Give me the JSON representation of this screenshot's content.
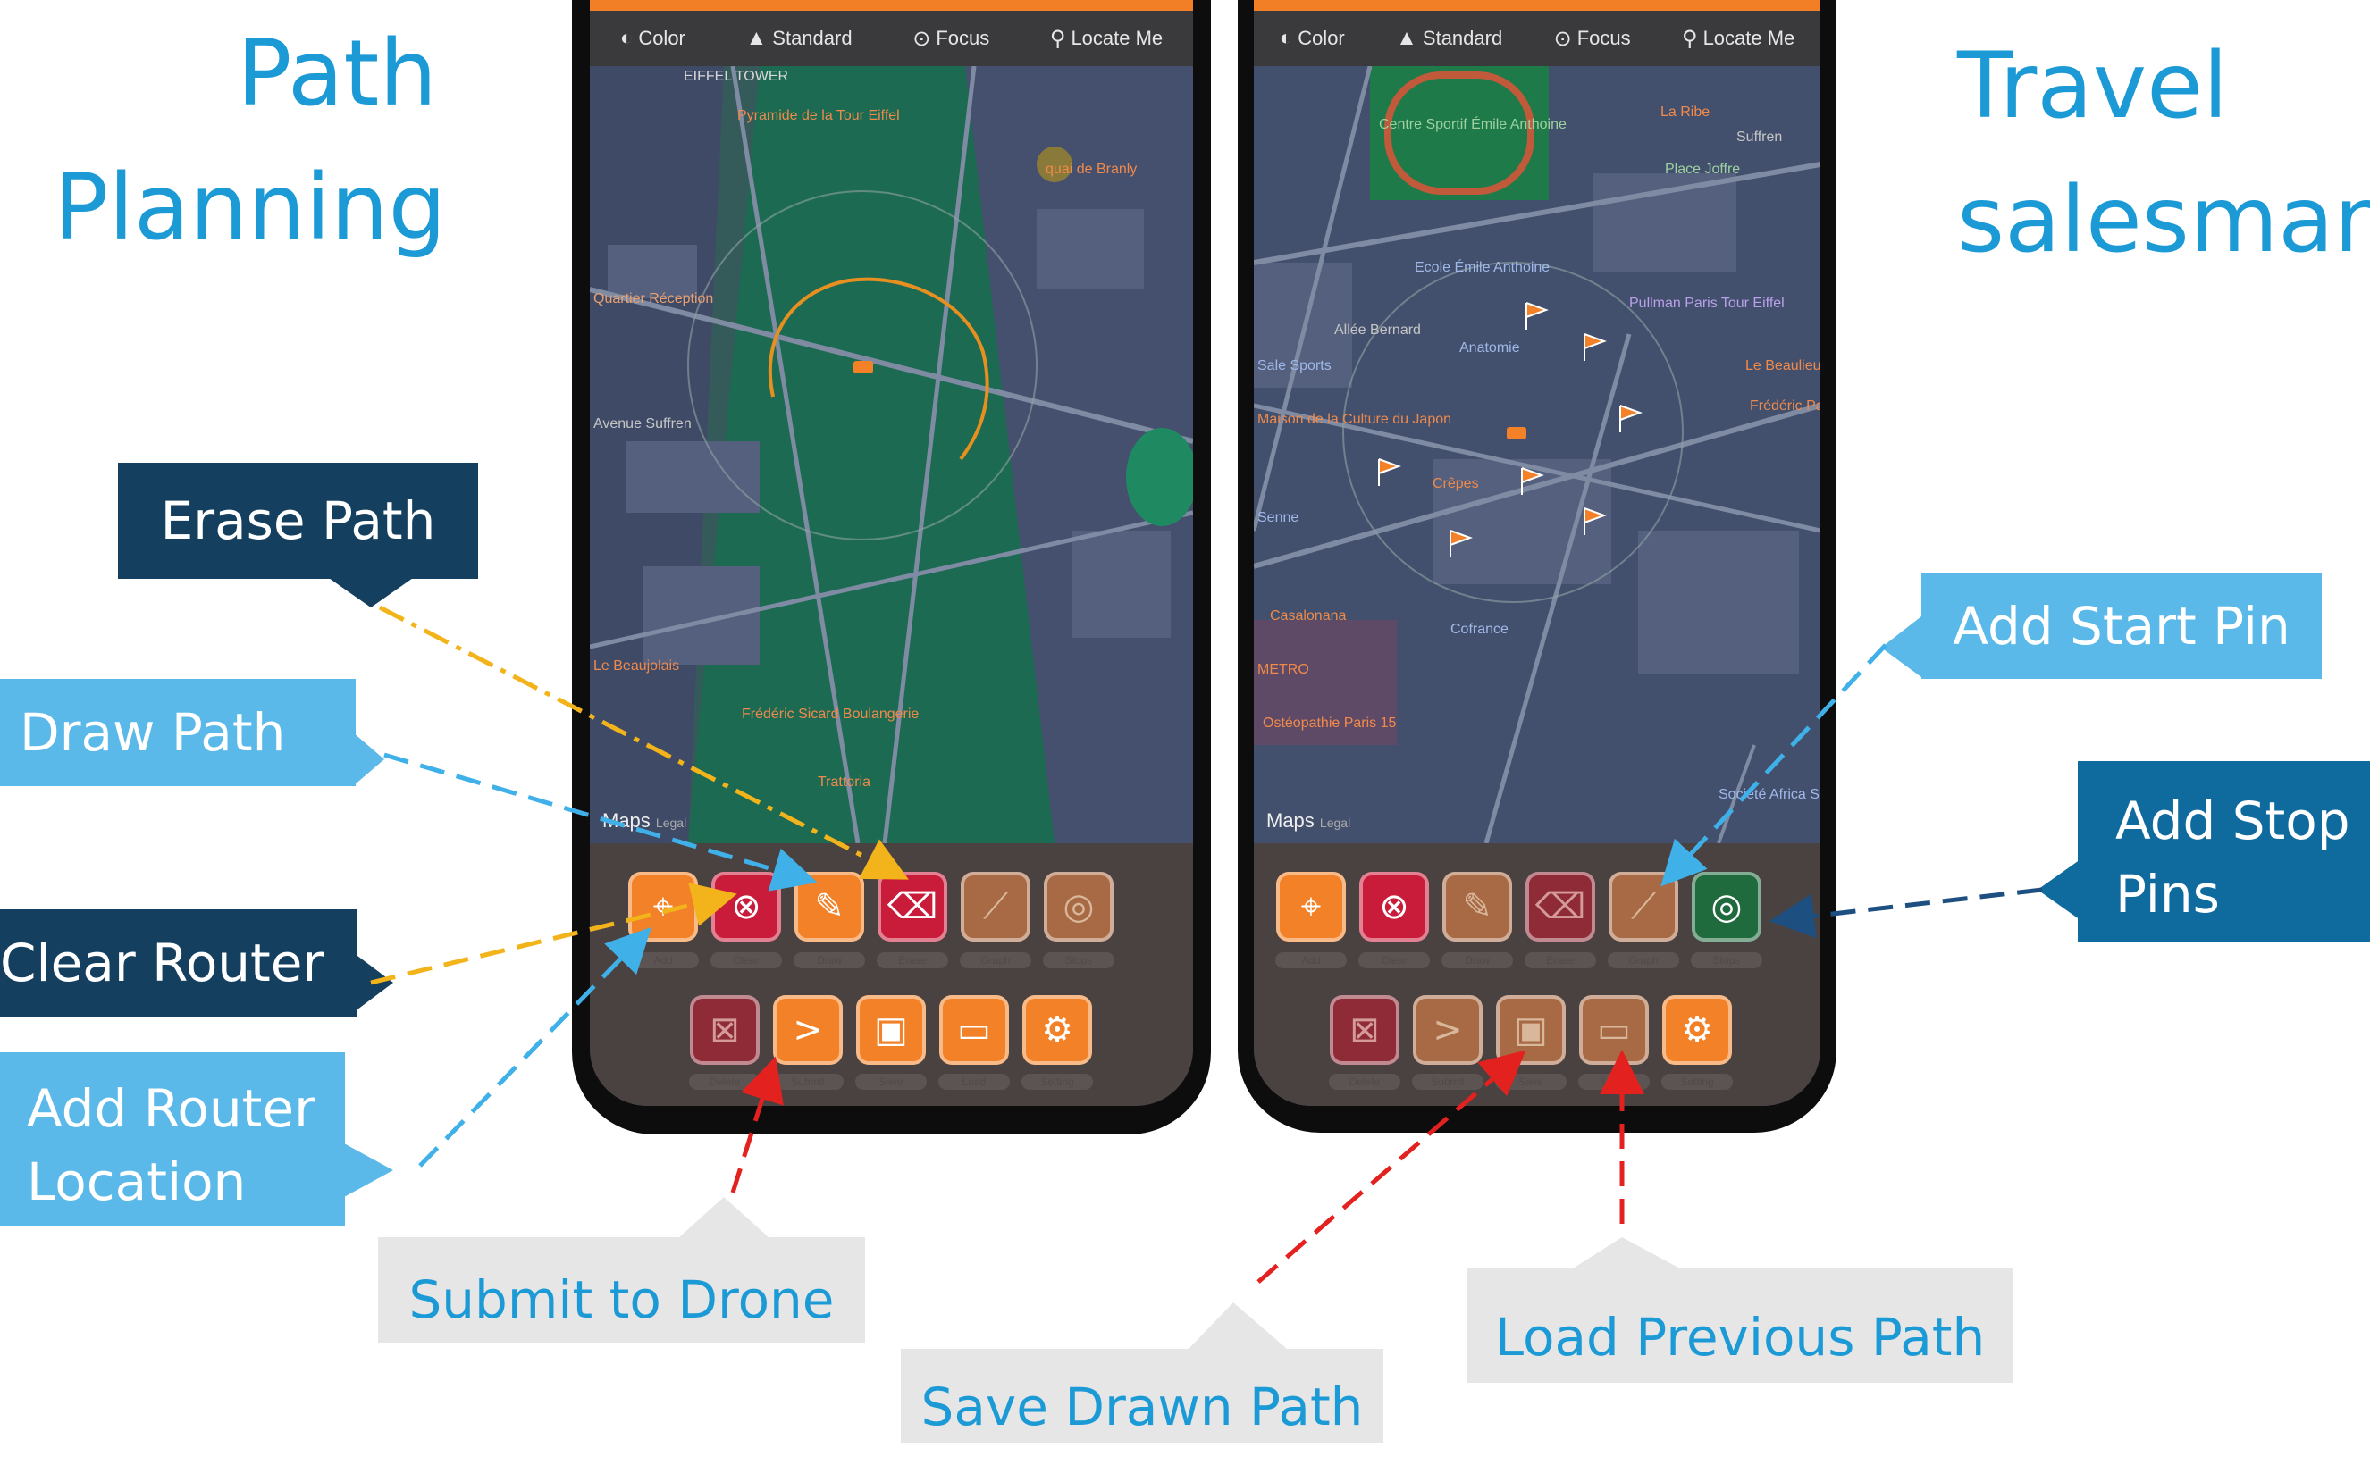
{
  "titles": {
    "left": [
      "Path",
      "Planning"
    ],
    "right": [
      "Travel",
      "salesman"
    ]
  },
  "toolbar": {
    "color": "Color",
    "standard": "Standard",
    "focus": "Focus",
    "locate": "Locate Me"
  },
  "map_attribution": "Maps",
  "map_attribution_small": "Legal",
  "left_map": {
    "labels": [
      "EIFFEL TOWER",
      "Pyramide de la Tour Eiffel",
      "quai de Branly",
      "Quartier Réception",
      "Avenue Suffren",
      "Le Beaujolais",
      "Frédéric Sicard Boulangerie",
      "Trattoria"
    ]
  },
  "right_map": {
    "labels": [
      "Centre Sportif Émile Anthoine",
      "La Ribe",
      "Suffren",
      "Place Joffre",
      "Ecole Émile Anthoine",
      "Pullman Paris Tour Eiffel",
      "Sale Sports",
      "Maison de la Culture du Japon",
      "Le Beaulieu",
      "Frédéric Paris",
      "Senne",
      "Casalonana",
      "Cofrance",
      "METRO",
      "Ostéopathie Paris 15",
      "Crêpes",
      "Société Africa Story",
      "Anatomie",
      "Allée Bernard"
    ]
  },
  "row1_labels": [
    "Add",
    "Clear",
    "Draw",
    "Erase",
    "Graph",
    "Stops"
  ],
  "row2_labels": [
    "Delete",
    "Submit",
    "Save",
    "Load",
    "Setting"
  ],
  "callouts": {
    "erase_path": "Erase Path",
    "draw_path": "Draw Path",
    "clear_router": "Clear Router",
    "add_router": [
      "Add Router",
      "Location"
    ],
    "submit": "Submit to Drone",
    "save": "Save Drawn Path",
    "load": "Load Previous Path",
    "add_start": "Add Start Pin",
    "add_stop": [
      "Add Stop",
      "Pins"
    ]
  },
  "colors": {
    "accent_orange": "#f28127",
    "title_blue": "#1b9ad6",
    "navy": "#143f5f",
    "cyan": "#5ab9e8",
    "teal": "#0f6a9e",
    "arrow_yellow": "#f2b41a",
    "arrow_red": "#e3211e"
  }
}
